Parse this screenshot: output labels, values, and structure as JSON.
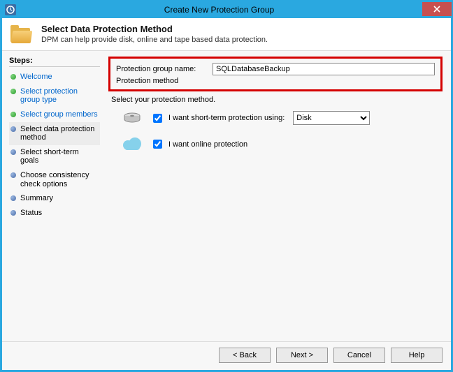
{
  "titlebar": {
    "title": "Create New Protection Group"
  },
  "header": {
    "heading": "Select Data Protection Method",
    "subtext": "DPM can help provide disk, online and tape based data protection."
  },
  "sidebar": {
    "heading": "Steps:",
    "items": [
      {
        "label": "Welcome",
        "state": "done",
        "link": true
      },
      {
        "label": "Select protection group type",
        "state": "done",
        "link": true
      },
      {
        "label": "Select group members",
        "state": "done",
        "link": true
      },
      {
        "label": "Select data protection method",
        "state": "current",
        "link": false
      },
      {
        "label": "Select short-term goals",
        "state": "todo",
        "link": false
      },
      {
        "label": "Choose consistency check options",
        "state": "todo",
        "link": false
      },
      {
        "label": "Summary",
        "state": "todo",
        "link": false
      },
      {
        "label": "Status",
        "state": "todo",
        "link": false
      }
    ]
  },
  "main": {
    "group_name_label": "Protection group name:",
    "group_name_value": "SQLDatabaseBackup",
    "method_label": "Protection method",
    "select_text": "Select your protection method.",
    "short_term": {
      "label": "I want short-term protection using:",
      "checked": true,
      "combo_options": [
        "Disk"
      ],
      "combo_value": "Disk"
    },
    "online": {
      "label": "I want online protection",
      "checked": true
    }
  },
  "footer": {
    "back": "< Back",
    "next": "Next >",
    "cancel": "Cancel",
    "help": "Help"
  }
}
